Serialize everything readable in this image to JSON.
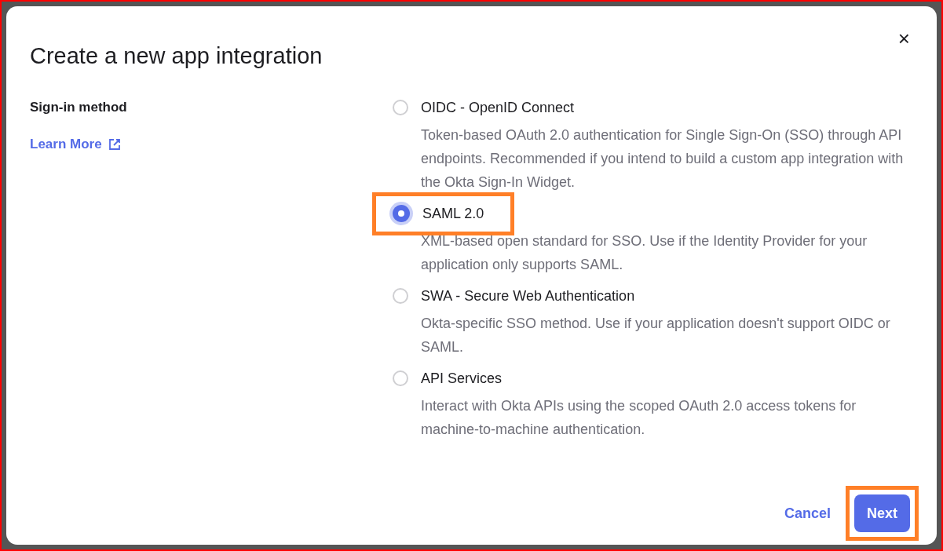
{
  "dialog": {
    "title": "Create a new app integration",
    "close": "×"
  },
  "sign_in_method": {
    "label": "Sign-in method",
    "link": "Learn More"
  },
  "options": [
    {
      "label": "OIDC - OpenID Connect",
      "description": "Token-based OAuth 2.0 authentication for Single Sign-On (SSO) through API endpoints. Recommended if you intend to build a custom app integration with the Okta Sign-In Widget.",
      "selected": false,
      "highlighted": false
    },
    {
      "label": "SAML 2.0",
      "description": "XML-based open standard for SSO. Use if the Identity Provider for your application only supports SAML.",
      "selected": true,
      "highlighted": true
    },
    {
      "label": "SWA - Secure Web Authentication",
      "description": "Okta-specific SSO method. Use if your application doesn't support OIDC or SAML.",
      "selected": false,
      "highlighted": false
    },
    {
      "label": "API Services",
      "description": "Interact with Okta APIs using the scoped OAuth 2.0 access tokens for machine-to-machine authentication.",
      "selected": false,
      "highlighted": false
    }
  ],
  "footer": {
    "cancel": "Cancel",
    "next": "Next",
    "next_highlighted": true
  }
}
